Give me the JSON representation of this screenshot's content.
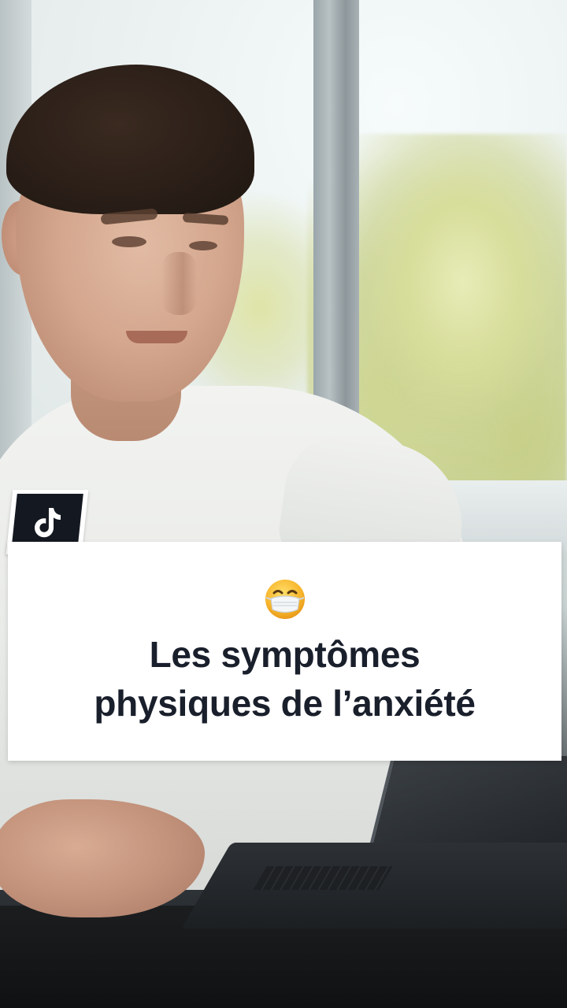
{
  "app": {
    "platform_icon": "tiktok-logo-icon"
  },
  "overlay": {
    "emoji": "😷",
    "title_line1": "Les symptômes",
    "title_line2": "physiques de l’anxiété"
  },
  "colors": {
    "card_background": "#ffffff",
    "title_text": "#1a1f2c",
    "badge_background": "#141821"
  }
}
